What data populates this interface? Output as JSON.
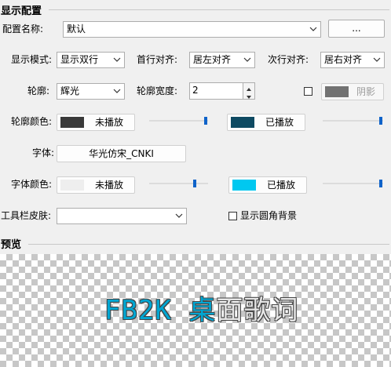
{
  "display": {
    "section_title": "显示配置",
    "config_name_label": "配置名称:",
    "config_name_value": "默认",
    "ellipsis_button": "...",
    "display_mode_label": "显示模式:",
    "display_mode_value": "显示双行",
    "first_line_align_label": "首行对齐:",
    "first_line_align_value": "居左对齐",
    "second_line_align_label": "次行对齐:",
    "second_line_align_value": "居右对齐",
    "outline_label": "轮廓:",
    "outline_value": "辉光",
    "outline_width_label": "轮廓宽度:",
    "outline_width_value": "2",
    "shadow_label": "阴影",
    "shadow_color": "#727272",
    "outline_color_label": "轮廓颜色:",
    "outline_color_unplayed": {
      "label": "未播放",
      "color": "#3a3a3a",
      "slider": 0.99
    },
    "outline_color_played": {
      "label": "已播放",
      "color": "#0e4a62",
      "slider": 0.99
    },
    "font_label": "字体:",
    "font_value": "华光仿宋_CNKI",
    "font_color_label": "字体颜色:",
    "font_color_unplayed": {
      "label": "未播放",
      "color": "#eeeeee",
      "slider": 0.76
    },
    "font_color_played": {
      "label": "已播放",
      "color": "#00c8f0",
      "slider": 0.99
    },
    "toolbar_skin_label": "工具栏皮肤:",
    "toolbar_skin_value": "",
    "rounded_bg_label": "显示圆角背景"
  },
  "preview": {
    "section_title": "预览",
    "lyric_played": "FB2K 桌",
    "lyric_unplayed": "面歌词",
    "played_color": "#00a6d2",
    "unplayed_color": "#e6e6e6"
  },
  "icons": {
    "dropdown": "chevron-down-icon",
    "spin_up": "spin-up-icon",
    "spin_down": "spin-down-icon"
  }
}
